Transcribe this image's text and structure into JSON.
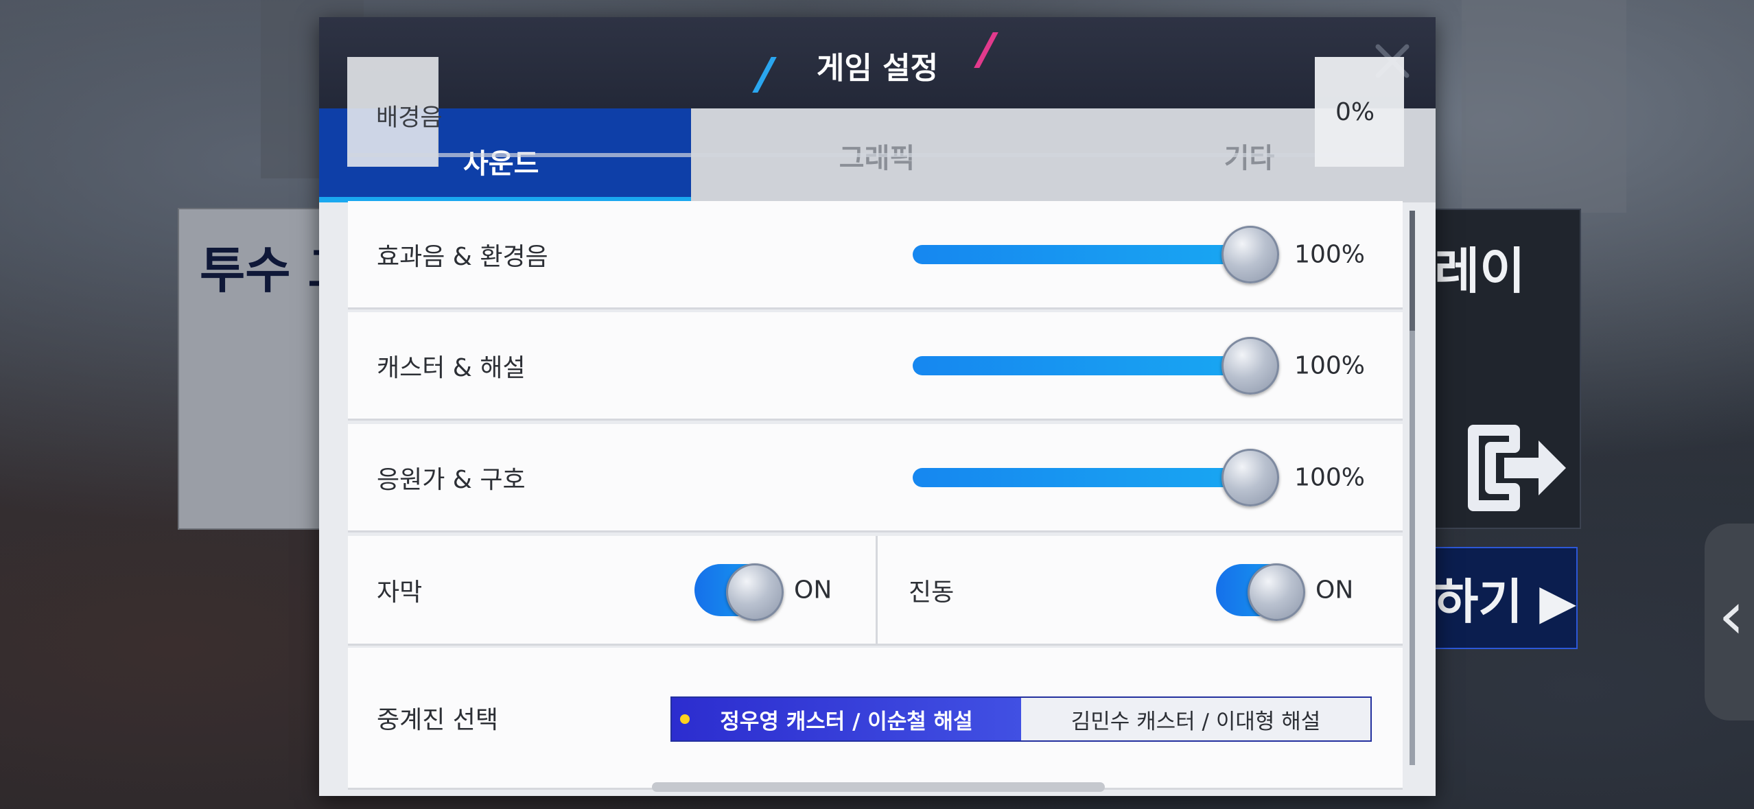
{
  "background": {
    "left_card_text": "투수 고",
    "right_card_text": "레이",
    "play_button_text": "하기 ▶",
    "side_tab_glyph": "‹"
  },
  "dialog": {
    "title": "게임 설정",
    "close_icon": "close-icon",
    "tabs": [
      {
        "label": "사운드",
        "active": true
      },
      {
        "label": "그래픽",
        "active": false
      },
      {
        "label": "기타",
        "active": false
      }
    ]
  },
  "sound": {
    "bgm": {
      "label": "배경음",
      "value": "0%"
    },
    "sliders": [
      {
        "label": "효과음 & 환경음",
        "value": "100%",
        "level": 1.0
      },
      {
        "label": "캐스터 & 해설",
        "value": "100%",
        "level": 1.0
      },
      {
        "label": "응원가 & 구호",
        "value": "100%",
        "level": 1.0
      }
    ],
    "toggles": [
      {
        "label": "자막",
        "state": "ON"
      },
      {
        "label": "진동",
        "state": "ON"
      }
    ],
    "caster": {
      "label": "중계진 선택",
      "options": [
        {
          "label": "정우영 캐스터 / 이순철 해설",
          "selected": true
        },
        {
          "label": "김민수 캐스터 / 이대형 해설",
          "selected": false
        }
      ]
    }
  },
  "colors": {
    "accent_blue": "#0e3fa8",
    "slider_blue": "#1687f0",
    "caster_selected": "#2c2dcf",
    "header_bg": "#232838"
  }
}
